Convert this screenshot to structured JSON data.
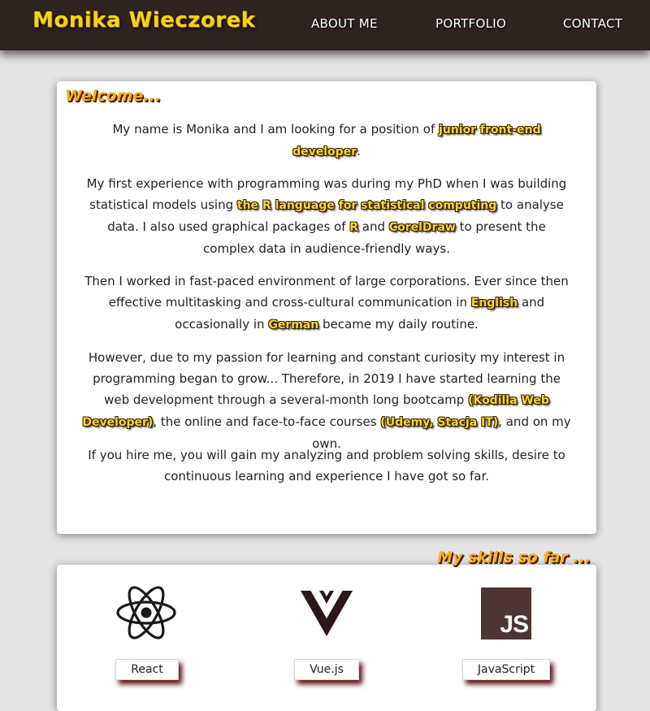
{
  "header": {
    "brand": "Monika Wieczorek",
    "nav": [
      "ABOUT ME",
      "PORTFOLIO",
      "CONTACT"
    ]
  },
  "welcome": {
    "title": "Welcome...",
    "p1": {
      "a": "My name is Monika and I am looking for a position of ",
      "h1": "junior front-end developer",
      "b": "."
    },
    "p2": {
      "a": "My first experience with programming was during my PhD when I was building statistical models using ",
      "h1": "the R language for statistical computing",
      "b": " to analyse data. I also used graphical packages of ",
      "h2": "R",
      "c": " and ",
      "h3": "CorelDraw",
      "d": " to present the complex data in audience-friendly ways."
    },
    "p3": {
      "a": "Then I worked in fast-paced environment of large corporations. Ever since then effective multitasking and cross-cultural communication in ",
      "h1": "English",
      "b": " and occasionally in ",
      "h2": "German",
      "c": " became my daily routine."
    },
    "p4": {
      "a": "However, due to my passion for learning and constant curiosity my interest in programming began to grow... Therefore, in 2019 I have started learning the web development through a several-month long bootcamp ",
      "h1": "(Kodilla Web Developer)",
      "b": ", the online and face-to-face courses ",
      "h2": "(Udemy, Stacja IT)",
      "c": ", and on my own."
    },
    "p5": "If you hire me, you will gain my analyzing and problem solving skills, desire to continuous learning and experience I have got so far."
  },
  "skills": {
    "title": "My skills so far ...",
    "items": [
      {
        "label": "React",
        "icon": "react-icon"
      },
      {
        "label": "Vue.js",
        "icon": "vue-icon"
      },
      {
        "label": "JavaScript",
        "icon": "javascript-icon",
        "icon_text": "JS"
      }
    ]
  }
}
